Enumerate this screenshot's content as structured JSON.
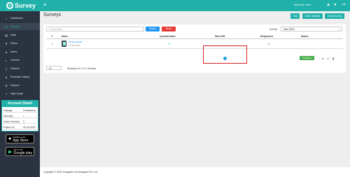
{
  "brand": {
    "name": "Survey"
  },
  "topbar": {
    "welcome": "Welcome, User"
  },
  "sidebar": {
    "items": [
      {
        "label": "Dashboard",
        "icon": "home-icon"
      },
      {
        "label": "Surveys",
        "icon": "list-icon"
      },
      {
        "label": "Data",
        "icon": "database-icon"
      },
      {
        "label": "Filters",
        "icon": "filter-icon"
      },
      {
        "label": "Users",
        "icon": "user-icon"
      },
      {
        "label": "Themes",
        "icon": "palette-icon"
      },
      {
        "label": "Devices",
        "icon": "device-icon"
      },
      {
        "label": "Purchase History",
        "icon": "dollar-icon"
      },
      {
        "label": "Support",
        "icon": "gear-icon"
      },
      {
        "label": "Help Guide",
        "icon": "help-icon"
      }
    ]
  },
  "account": {
    "title": "Account Detail",
    "rows": [
      {
        "k": "Package",
        "v": "Professional"
      },
      {
        "k": "Device(s)",
        "v": "1"
      },
      {
        "k": "Active Device(s)",
        "v": "0"
      },
      {
        "k": "Expires On",
        "v": "26 Jun 2022"
      }
    ]
  },
  "stores": {
    "apple_small": "Available on the",
    "apple_big": "App Store",
    "google_small": "GET IT ON",
    "google_big": "Google play"
  },
  "page": {
    "title": "Surveys"
  },
  "header_buttons": {
    "help": "Help",
    "clear": "Clear Template",
    "create": "Create Survey"
  },
  "search": {
    "placeholder": "Survey Name",
    "search_btn": "Search",
    "reset_btn": "Reset"
  },
  "sort": {
    "label": "Sort By",
    "value": "Date DESC"
  },
  "table": {
    "headers": [
      "#",
      "Name",
      "Questionnaire",
      "Web URL",
      "Responses",
      "Status"
    ],
    "row": {
      "num": "1",
      "name": "Survey Name",
      "date": "11 May 2022",
      "responses": "0",
      "status": "Published"
    }
  },
  "pagination": {
    "per_page": "10",
    "showing": "Showing 1 to 1 of 1 Surveys"
  },
  "footer": {
    "copyright": "Copyright © 2022 Techgrains Technologies Pvt. Ltd."
  },
  "colors": {
    "teal": "#20b2aa",
    "sidebar": "#2b3340",
    "red": "#d8201e",
    "blue": "#2196f3",
    "green": "#4caf50"
  }
}
